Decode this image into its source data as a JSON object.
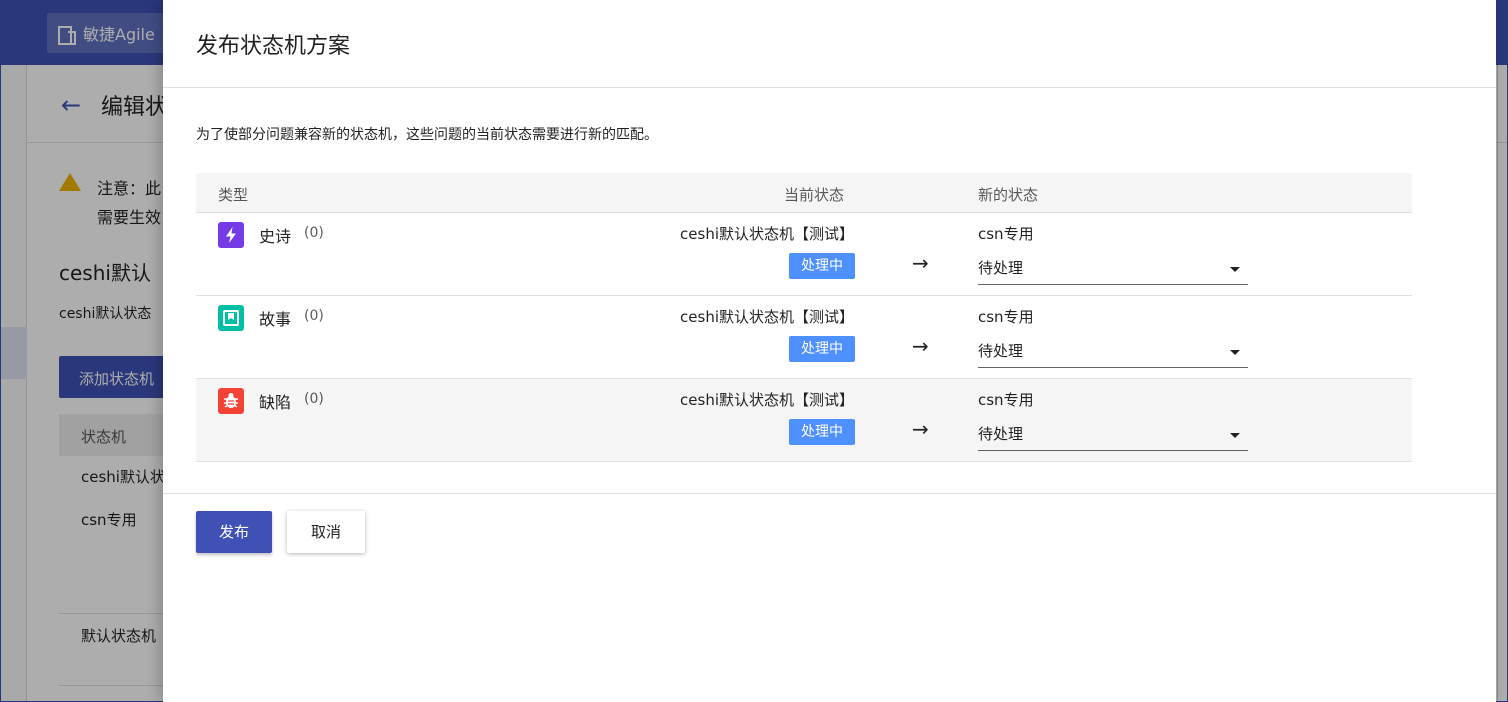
{
  "background": {
    "project_name": "敏捷Agile",
    "page_title": "编辑状",
    "warning_line1": "注意：此",
    "warning_line2": "需要生效",
    "scheme_name": "ceshi默认",
    "scheme_desc": "ceshi默认状态",
    "add_button": "添加状态机",
    "table_header": "状态机",
    "rows": [
      "ceshi默认状",
      "csn专用",
      "默认状态机"
    ]
  },
  "dialog": {
    "title": "发布状态机方案",
    "tip": "为了使部分问题兼容新的状态机，这些问题的当前状态需要进行新的匹配。",
    "columns": {
      "type": "类型",
      "current": "当前状态",
      "new": "新的状态"
    },
    "rows": [
      {
        "icon": "epic-lightning-icon",
        "type": "史诗",
        "count": "(0)",
        "current_machine": "ceshi默认状态机【测试】",
        "current_status": "处理中",
        "arrow": "→",
        "new_machine": "csn专用",
        "new_status": "待处理"
      },
      {
        "icon": "story-bookmark-icon",
        "type": "故事",
        "count": "(0)",
        "current_machine": "ceshi默认状态机【测试】",
        "current_status": "处理中",
        "arrow": "→",
        "new_machine": "csn专用",
        "new_status": "待处理"
      },
      {
        "icon": "bug-icon",
        "type": "缺陷",
        "count": "(0)",
        "current_machine": "ceshi默认状态机【测试】",
        "current_status": "处理中",
        "arrow": "→",
        "new_machine": "csn专用",
        "new_status": "待处理"
      }
    ],
    "publish_button": "发布",
    "cancel_button": "取消"
  },
  "colors": {
    "primary": "#3f51b5",
    "status_tag": "#4d90fe",
    "epic": "#743be7",
    "story": "#00bfa5",
    "bug": "#f44336"
  }
}
